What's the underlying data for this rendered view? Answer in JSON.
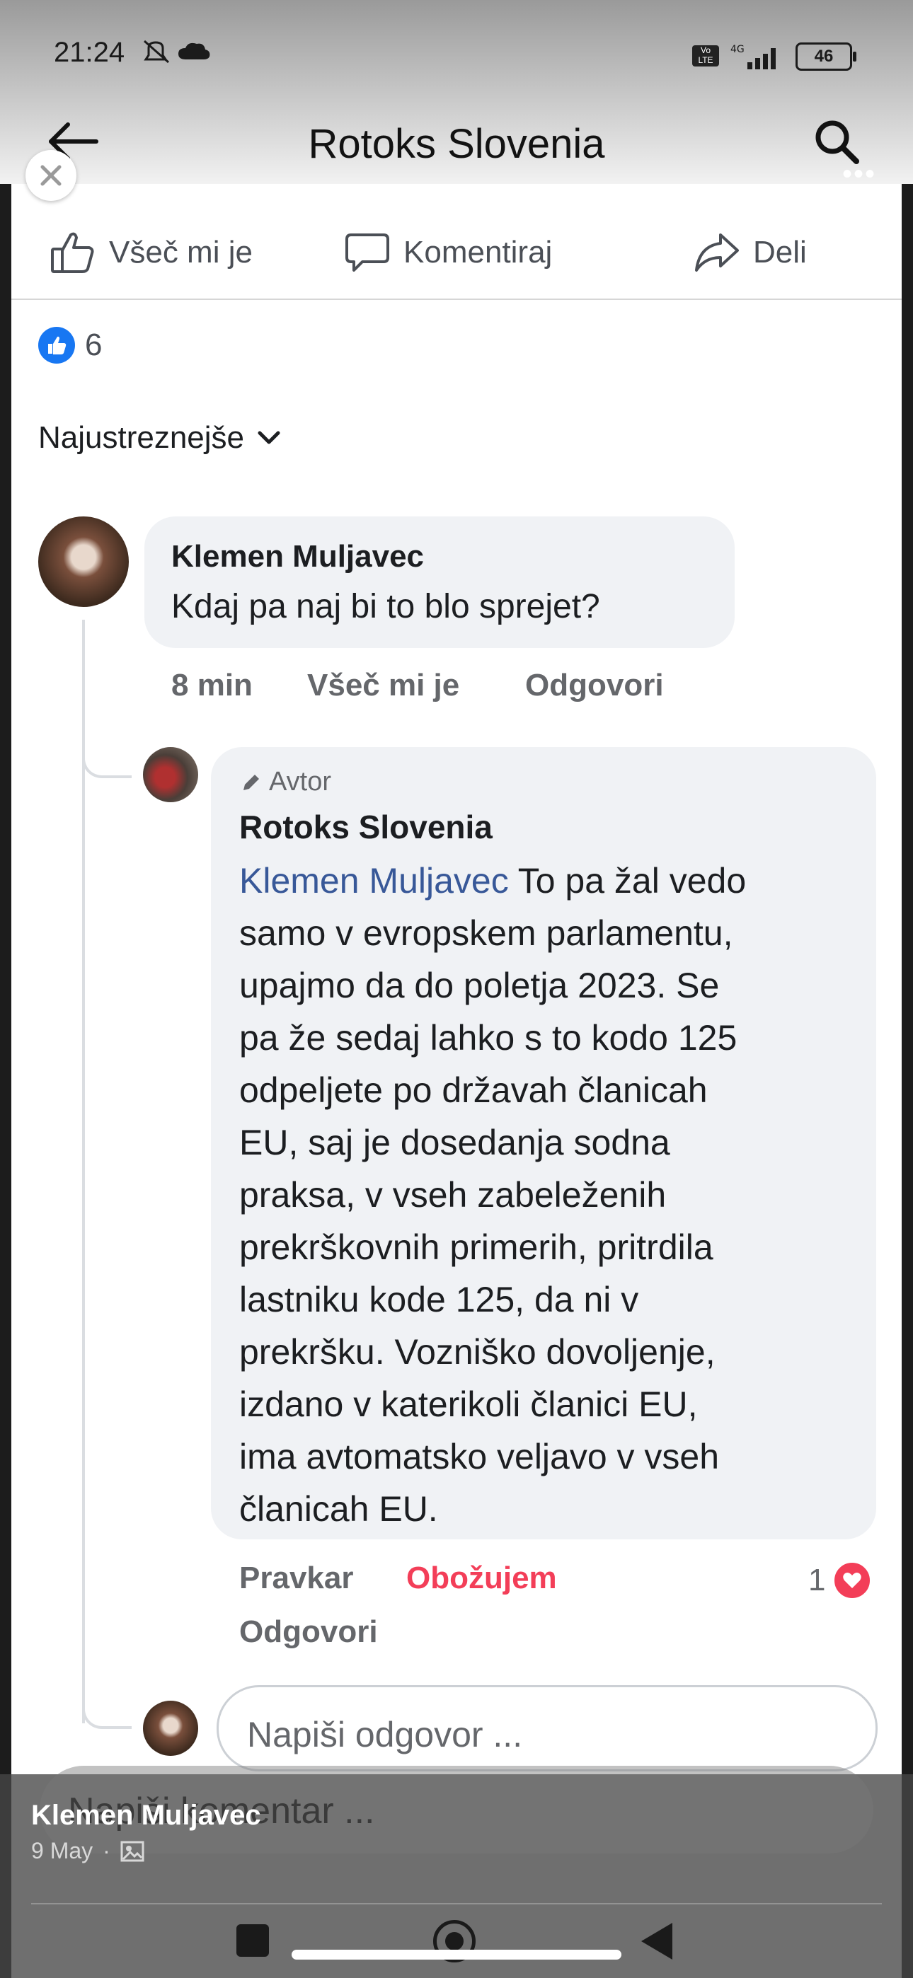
{
  "status_bar": {
    "time": "21:24",
    "network": "4G",
    "battery": "46"
  },
  "header": {
    "title": "Rotoks Slovenia"
  },
  "post_actions": {
    "like": "Všeč mi je",
    "comment": "Komentiraj",
    "share": "Deli"
  },
  "reactions": {
    "count": "6"
  },
  "sort": {
    "label": "Najustreznejše"
  },
  "comments": [
    {
      "author": "Klemen Muljavec",
      "text": "Kdaj pa naj bi to blo sprejet?",
      "time": "8 min",
      "like_label": "Všeč mi je",
      "reply_label": "Odgovori"
    }
  ],
  "reply": {
    "badge": "Avtor",
    "author": "Rotoks Slovenia",
    "mention": "Klemen Muljavec",
    "text": "To pa žal vedo\nsamo v evropskem parlamentu,\nupajmo da do poletja 2023. Se\npa že sedaj lahko s to kodo 125\nodpeljete po državah članicah\nEU, saj je dosedanja sodna\npraksa, v vseh zabeleženih\nprekrškovnih primerih, pritrdila\nlastniku kode 125, da ni v\nprekršku. Vozniško dovoljenje,\nizdano v katerikoli članici EU,\nima avtomatsko veljavo v vseh\nčlanicah EU.",
    "time": "Pravkar",
    "reaction_label": "Obožujem",
    "reaction_count": "1",
    "reply_label": "Odgovori"
  },
  "reply_input": {
    "placeholder": "Napiši odgovor ..."
  },
  "comment_input": {
    "placeholder": "Napiši komentar ..."
  },
  "overlay": {
    "author": "Klemen Muljavec",
    "date": "9 May"
  },
  "colors": {
    "facebook_blue": "#1877f2",
    "love_red": "#f33e58",
    "mention_blue": "#385898"
  }
}
